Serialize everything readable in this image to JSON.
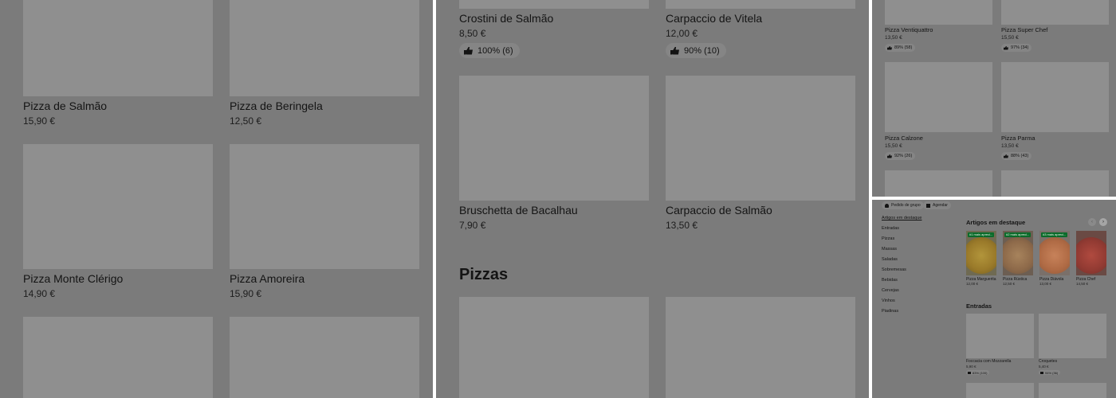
{
  "panel1": {
    "items": [
      {
        "name": "Pizza de Salmão",
        "price": "15,90 €"
      },
      {
        "name": "Pizza de Beringela",
        "price": "12,50 €"
      },
      {
        "name": "Pizza Monte Clérigo",
        "price": "14,90 €"
      },
      {
        "name": "Pizza Amoreira",
        "price": "15,90 €"
      }
    ]
  },
  "panel2": {
    "items": [
      {
        "name": "Crostini de Salmão",
        "price": "8,50 €",
        "rating": "100% (6)"
      },
      {
        "name": "Carpaccio de Vitela",
        "price": "12,00 €",
        "rating": "90% (10)"
      },
      {
        "name": "Bruschetta de Bacalhau",
        "price": "7,90 €"
      },
      {
        "name": "Carpaccio de Salmão",
        "price": "13,50 €"
      }
    ],
    "section_title": "Pizzas"
  },
  "panel3": {
    "items": [
      {
        "name": "Pizza Ventiquattro",
        "price": "13,50 €",
        "rating": "89% (58)"
      },
      {
        "name": "Pizza Super Chef",
        "price": "15,50 €",
        "rating": "97% (34)"
      },
      {
        "name": "Pizza Calzone",
        "price": "15,50 €",
        "rating": "92% (26)"
      },
      {
        "name": "Pizza Parma",
        "price": "13,50 €",
        "rating": "88% (43)"
      }
    ]
  },
  "panel4": {
    "chips": [
      {
        "label": "Pedido de grupo",
        "icon": "group-icon"
      },
      {
        "label": "Agendar",
        "icon": "calendar-icon"
      }
    ],
    "sidebar": [
      {
        "label": "Artigos em destaque",
        "active": true
      },
      {
        "label": "Entradas"
      },
      {
        "label": "Pizzas"
      },
      {
        "label": "Massas"
      },
      {
        "label": "Saladas"
      },
      {
        "label": "Sobremesas"
      },
      {
        "label": "Bebidas"
      },
      {
        "label": "Cervejas"
      },
      {
        "label": "Vinhos"
      },
      {
        "label": "Piadinas"
      }
    ],
    "featured_title": "Artigos em destaque",
    "featured": [
      {
        "name": "Pizza Marguerita",
        "price": "12,00 €",
        "badge": "#1 mais apreci..."
      },
      {
        "name": "Pizza Rústica",
        "price": "12,50 €",
        "badge": "#2 mais apreci..."
      },
      {
        "name": "Pizza Diávola",
        "price": "13,00 €",
        "badge": "#3 mais apreci..."
      },
      {
        "name": "Pizza Chef",
        "price": "14,50 €",
        "badge": ""
      }
    ],
    "entradas_title": "Entradas",
    "entradas": [
      {
        "name": "Foccacia com Mozzarella",
        "price": "5,90 €",
        "rating": "83% (100)"
      },
      {
        "name": "Croquetes",
        "price": "5,40 €",
        "rating": "94% (36)"
      }
    ]
  }
}
